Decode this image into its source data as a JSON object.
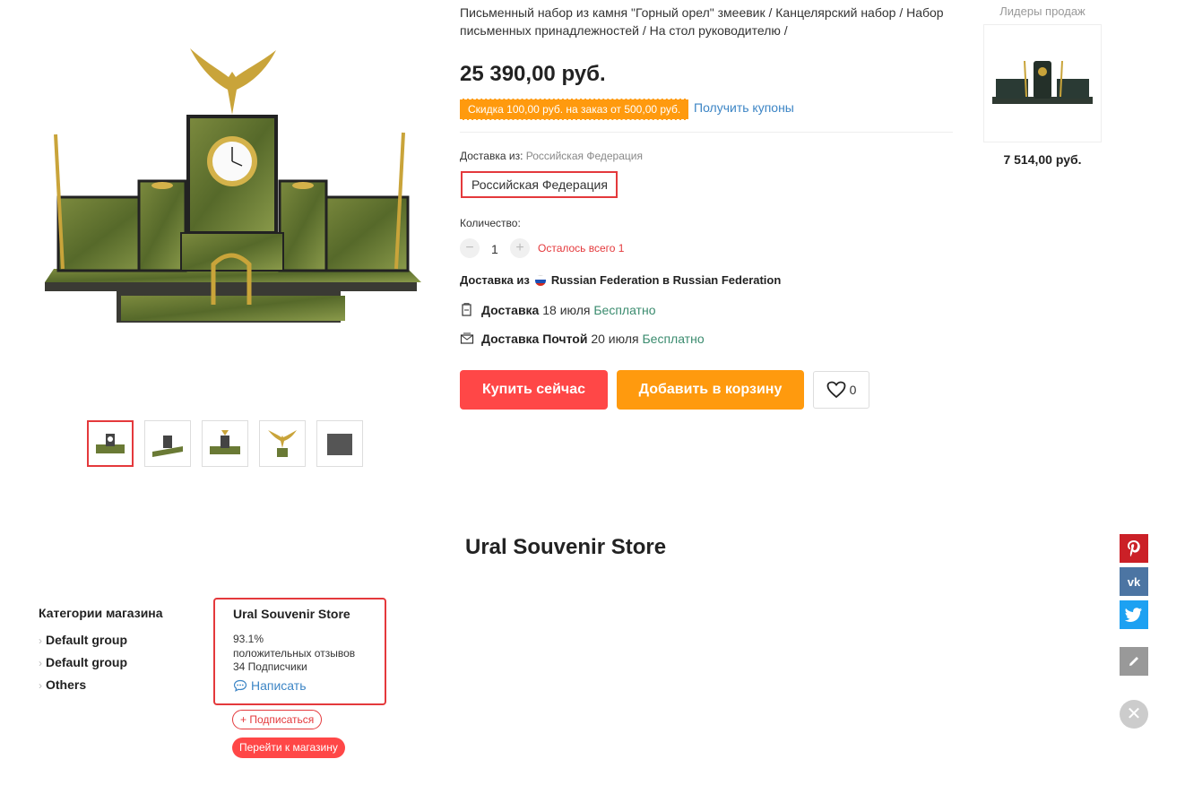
{
  "product": {
    "title": "Письменный набор из камня \"Горный орел\" змеевик / Канцелярский набор / Набор письменных принадлежностей / На стол руководителю /",
    "price": "25 390,00 руб.",
    "discount": "Скидка 100,00 руб. на заказ от 500,00 руб.",
    "coupon_link": "Получить купоны",
    "delivery_from_label": "Доставка из:",
    "delivery_from_value": "Российская Федерация",
    "country_selected": "Российская Федерация",
    "quantity_label": "Количество:",
    "quantity": "1",
    "stock_left": "Осталось всего 1",
    "shipping_route_prefix": "Доставка из",
    "shipping_route": "Russian Federation в Russian Federation",
    "shipping_options": [
      {
        "method": "Доставка",
        "date": "18 июля",
        "cost": "Бесплатно"
      },
      {
        "method": "Доставка Почтой",
        "date": "20 июля",
        "cost": "Бесплатно"
      }
    ],
    "buy_now": "Купить сейчас",
    "add_to_cart": "Добавить в корзину",
    "wishlist_count": "0",
    "thumbnail_count": 5,
    "active_thumbnail": 1
  },
  "top_sellers": {
    "title": "Лидеры продаж",
    "items": [
      {
        "price": "7 514,00 руб."
      }
    ]
  },
  "store": {
    "heading": "Ural Souvenir Store",
    "categories_title": "Категории магазина",
    "categories": [
      "Default group",
      "Default group",
      "Others"
    ],
    "card": {
      "name": "Ural Souvenir Store",
      "rating_percent": "93.1%",
      "rating_label": "положительных отзывов",
      "followers": "34 Подписчики",
      "message": "Написать"
    },
    "follow": "+ Подписаться",
    "go_to_store": "Перейти к магазину"
  },
  "colors": {
    "accent_red": "#ff4747",
    "accent_orange": "#ff9a0e",
    "link_blue": "#3c85c5",
    "free_green": "#3a8b6e"
  }
}
